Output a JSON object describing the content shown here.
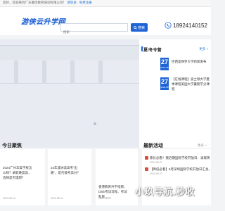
{
  "topbar": {
    "text": "您好，欢迎来到广东最佳教育培训有限公司！",
    "links": "请登录 · 免费注册"
  },
  "header": {
    "logo": "游侠云升学网",
    "search_placeholder": "搜索",
    "search_button": "搜索",
    "phone": "18924140152"
  },
  "side_panel": {
    "title": "夏/冬令营",
    "more": "更多 »",
    "items": [
      {
        "day": "27",
        "ym": "2024-08",
        "text": "巴西圣保罗大学新闻发布"
      },
      {
        "day": "27",
        "ym": "2024-08",
        "text": "【在线课程】波士顿大学夏季课程美国大学暑期学分课程"
      }
    ]
  },
  "today_section": {
    "title": "今日聚焦"
  },
  "cards": [
    {
      "text": "2024广州华美学校怎么样？录取难度高，选择是否理想？",
      "date": "2024-08-12"
    },
    {
      "text": "24年澳洲读高考“出路”，是否能考高分？",
      "date": "2024-08-12"
    },
    {
      "text": "香港教育升学指南：DSE考试流程、考试科目……",
      "date": "2024-08-12"
    }
  ],
  "news_section": {
    "title": "最新活动",
    "more": "更多 »"
  },
  "news": [
    {
      "text": "家长必看！我近期国际学校开放日、录取简章一览",
      "date": "2024-06-27"
    },
    {
      "text": "【降低必看】6月深圳国际学校开放日汇总，重一…",
      "date": "2024-06-27"
    }
  ],
  "watermark": "小玖导航.秒收",
  "colors": {
    "brand": "#1e64d6",
    "accent_red": "#e04a3a"
  }
}
